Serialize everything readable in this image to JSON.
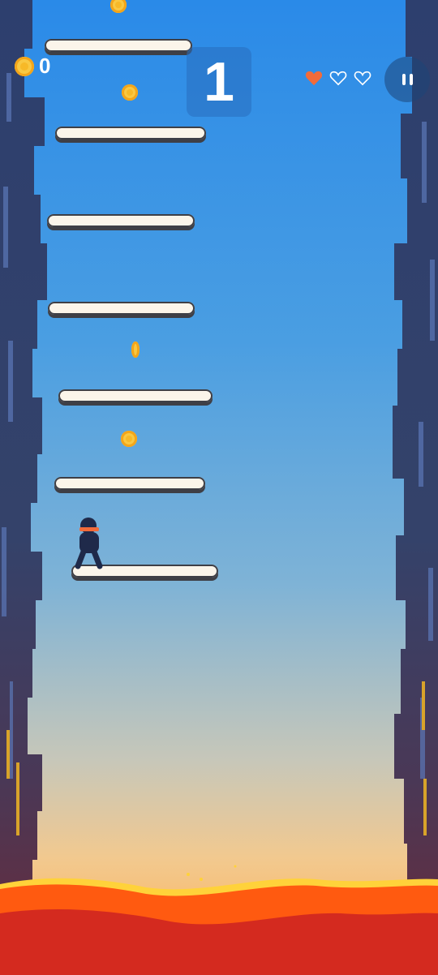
{
  "hud": {
    "coin_icon": "coin-icon",
    "coin_count": "0",
    "score": "1",
    "lives": [
      {
        "icon": "heart-filled-icon",
        "filled": true
      },
      {
        "icon": "heart-outline-icon",
        "filled": false
      },
      {
        "icon": "heart-outline-icon",
        "filled": false
      }
    ],
    "pause_icon": "pause-icon"
  },
  "colors": {
    "heart_filled": "#f26b3a",
    "heart_outline": "#ffffff",
    "lava": "#d42a1f",
    "lava_top": "#ff5a10",
    "coin": "#f7b928",
    "platform": "#fbf5ea"
  }
}
